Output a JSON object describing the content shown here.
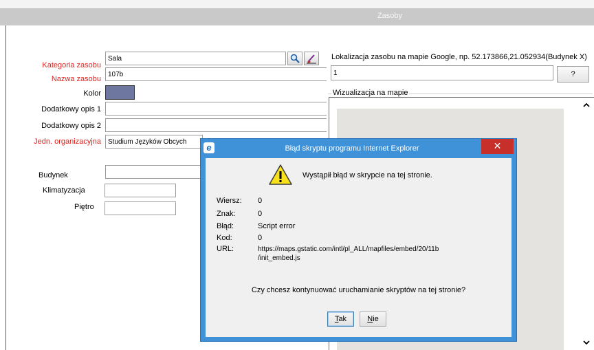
{
  "window": {
    "title": "Zasoby"
  },
  "form": {
    "category_label": "Kategoria zasobu",
    "category_value": "Sala",
    "name_label": "Nazwa zasobu",
    "name_value": "107b",
    "color_label": "Kolor",
    "color_value": "#6d77a0",
    "desc1_label": "Dodatkowy opis 1",
    "desc1_value": "",
    "desc2_label": "Dodatkowy opis 2",
    "desc2_value": "",
    "unit_label": "Jedn. organizacyjna",
    "unit_value": "Studium Języków Obcych",
    "building_label": "Budynek",
    "building_value": "",
    "ac_label": "Klimatyzacja",
    "ac_value": "",
    "floor_label": "Piętro",
    "floor_value": ""
  },
  "map": {
    "location_label": "Lokalizacja zasobu na mapie Google, np. 52.173866,21.052934(Budynek X)",
    "location_value": "1",
    "help_button": "?",
    "visualization_label": "Wizualizacja na mapie"
  },
  "dialog": {
    "title": "Błąd skryptu programu Internet Explorer",
    "message": "Wystąpił błąd w skrypcie na tej stronie.",
    "fields": [
      {
        "key": "Wiersz:",
        "value": "0"
      },
      {
        "key": "Znak:",
        "value": "0"
      },
      {
        "key": "Błąd:",
        "value": "Script error"
      },
      {
        "key": "Kod:",
        "value": "0"
      },
      {
        "key": "URL:",
        "value": "https://maps.gstatic.com/intl/pl_ALL/mapfiles/embed/20/11b/init_embed.js"
      }
    ],
    "url_line1": "https://maps.gstatic.com/intl/pl_ALL/mapfiles/embed/20/11b",
    "url_line2": "/init_embed.js",
    "question": "Czy chcesz kontynuować uruchamianie skryptów na tej stronie?",
    "yes_prefix": "",
    "yes_accel": "T",
    "yes_rest": "ak",
    "no_accel": "N",
    "no_rest": "ie",
    "close_glyph": "✕",
    "ie_glyph": "e"
  }
}
